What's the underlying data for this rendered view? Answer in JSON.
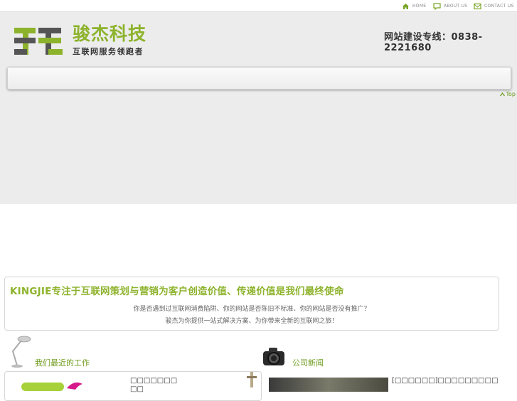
{
  "topnav": {
    "home": "HOME",
    "about": "ABOUT US",
    "contact": "CONTACT US"
  },
  "brand": {
    "name": "骏杰科技",
    "slogan": "互联网服务领跑者",
    "hotline": "网站建设专线：0838-2221680"
  },
  "to_top": "Top",
  "mission": {
    "title": "KINGJIE专注于互联网策划与营销为客户创造价值、传递价值是我们最终使命",
    "line1": "你是否遇到过互联网消费陷阱、你的网站是否陈旧不标准、你的网站是否没有推广？",
    "line2": "骏杰为你提供一站式解决方案、为你带来全新的互联网之旅！"
  },
  "sections": {
    "recent_work": "我们最近的工作",
    "company_news": "公司新闻"
  },
  "work_item": {
    "line1": "□□□□□□□",
    "line2": "□□"
  },
  "news_item": "[□□□□□□]□□□□□□□□□",
  "colors": {
    "accent": "#8db32c",
    "header_bg": "#ececec"
  }
}
